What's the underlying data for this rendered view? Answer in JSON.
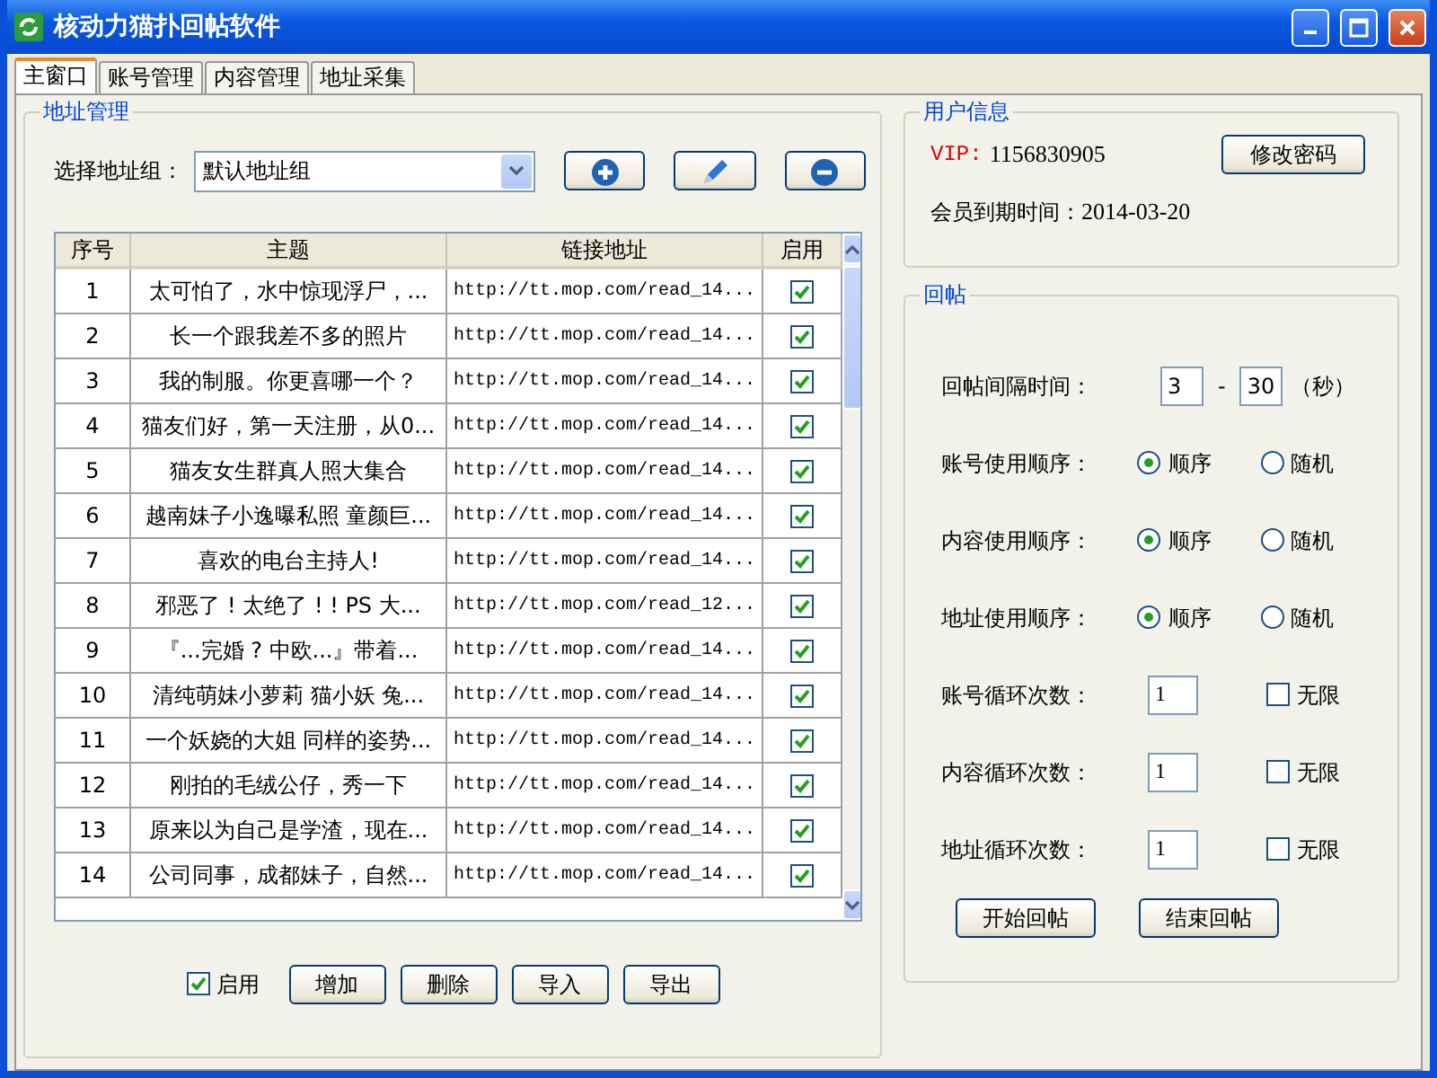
{
  "window": {
    "title": "核动力猫扑回帖软件"
  },
  "tabs": [
    {
      "label": "主窗口",
      "selected": true
    },
    {
      "label": "账号管理",
      "selected": false
    },
    {
      "label": "内容管理",
      "selected": false
    },
    {
      "label": "地址采集",
      "selected": false
    }
  ],
  "address_panel": {
    "title": "地址管理",
    "select_label": "选择地址组：",
    "select_value": "默认地址组"
  },
  "table": {
    "columns": [
      "序号",
      "主题",
      "链接地址",
      "启用"
    ],
    "rows": [
      {
        "index": "1",
        "title": "太可怕了，水中惊现浮尸，...",
        "url": "http://tt.mop.com/read_14...",
        "enabled": true
      },
      {
        "index": "2",
        "title": "长一个跟我差不多的照片",
        "url": "http://tt.mop.com/read_14...",
        "enabled": true
      },
      {
        "index": "3",
        "title": "我的制服。你更喜哪一个？",
        "url": "http://tt.mop.com/read_14...",
        "enabled": true
      },
      {
        "index": "4",
        "title": "猫友们好，第一天注册，从0...",
        "url": "http://tt.mop.com/read_14...",
        "enabled": true
      },
      {
        "index": "5",
        "title": "猫友女生群真人照大集合",
        "url": "http://tt.mop.com/read_14...",
        "enabled": true
      },
      {
        "index": "6",
        "title": "越南妹子小逸曝私照 童颜巨...",
        "url": "http://tt.mop.com/read_14...",
        "enabled": true
      },
      {
        "index": "7",
        "title": "喜欢的电台主持人!",
        "url": "http://tt.mop.com/read_14...",
        "enabled": true
      },
      {
        "index": "8",
        "title": "邪恶了 ! 太绝了 ! ! PS 大...",
        "url": "http://tt.mop.com/read_12...",
        "enabled": true
      },
      {
        "index": "9",
        "title": "『...完婚 ? 中欧...』带着...",
        "url": "http://tt.mop.com/read_14...",
        "enabled": true
      },
      {
        "index": "10",
        "title": "清纯萌妹小萝莉 猫小妖 兔...",
        "url": "http://tt.mop.com/read_14...",
        "enabled": true
      },
      {
        "index": "11",
        "title": "一个妖娆的大姐 同样的姿势...",
        "url": "http://tt.mop.com/read_14...",
        "enabled": true
      },
      {
        "index": "12",
        "title": "刚拍的毛绒公仔，秀一下",
        "url": "http://tt.mop.com/read_14...",
        "enabled": true
      },
      {
        "index": "13",
        "title": "原来以为自己是学渣，现在...",
        "url": "http://tt.mop.com/read_14...",
        "enabled": true
      },
      {
        "index": "14",
        "title": "公司同事，成都妹子，自然...",
        "url": "http://tt.mop.com/read_14...",
        "enabled": true
      }
    ]
  },
  "table_footer": {
    "enable_label": "启用",
    "enable_checked": true,
    "buttons": [
      "增加",
      "删除",
      "导入",
      "导出"
    ]
  },
  "user_info": {
    "title": "用户信息",
    "vip_label": "VIP:",
    "vip_value": "1156830905",
    "change_password": "修改密码",
    "expiry_label": "会员到期时间：",
    "expiry_value": "2014-03-20"
  },
  "reply": {
    "title": "回帖",
    "interval_label": "回帖间隔时间：",
    "interval_min": "3",
    "interval_dash": "-",
    "interval_max": "30",
    "interval_unit": "（秒）",
    "order_rows": [
      {
        "label": "账号使用顺序：",
        "options": [
          {
            "label": "顺序",
            "selected": true
          },
          {
            "label": "随机",
            "selected": false
          }
        ]
      },
      {
        "label": "内容使用顺序：",
        "options": [
          {
            "label": "顺序",
            "selected": true
          },
          {
            "label": "随机",
            "selected": false
          }
        ]
      },
      {
        "label": "地址使用顺序：",
        "options": [
          {
            "label": "顺序",
            "selected": true
          },
          {
            "label": "随机",
            "selected": false
          }
        ]
      }
    ],
    "loop_rows": [
      {
        "label": "账号循环次数：",
        "value": "1",
        "unlimited_label": "无限",
        "unlimited": false
      },
      {
        "label": "内容循环次数：",
        "value": "1",
        "unlimited_label": "无限",
        "unlimited": false
      },
      {
        "label": "地址循环次数：",
        "value": "1",
        "unlimited_label": "无限",
        "unlimited": false
      }
    ],
    "buttons": [
      "开始回帖",
      "结束回帖"
    ]
  }
}
